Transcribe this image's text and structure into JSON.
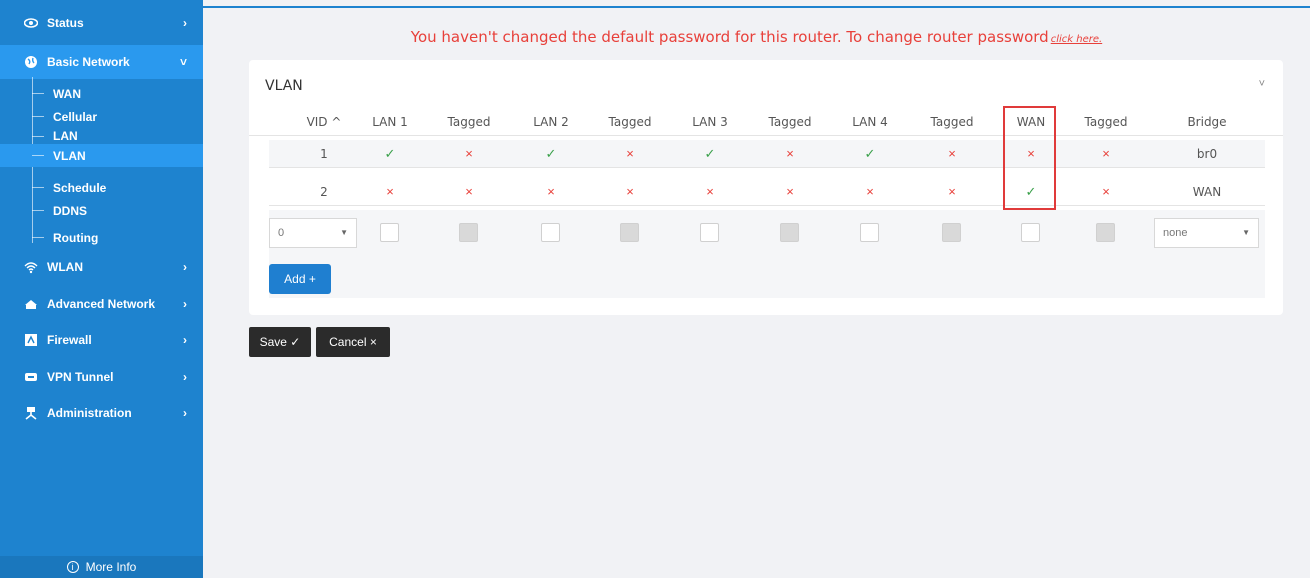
{
  "sidebar": {
    "items": [
      {
        "label": "Status",
        "icon": "eye-icon",
        "chevron": "›"
      },
      {
        "label": "Basic Network",
        "icon": "globe-icon",
        "chevron": "˅"
      },
      {
        "label": "WLAN",
        "icon": "wifi-icon",
        "chevron": "›"
      },
      {
        "label": "Advanced Network",
        "icon": "router-icon",
        "chevron": "›"
      },
      {
        "label": "Firewall",
        "icon": "firewall-icon",
        "chevron": "›"
      },
      {
        "label": "VPN Tunnel",
        "icon": "vpn-icon",
        "chevron": "›"
      },
      {
        "label": "Administration",
        "icon": "admin-icon",
        "chevron": "›"
      }
    ],
    "submenu": [
      "WAN",
      "Cellular",
      "LAN",
      "VLAN",
      "Schedule",
      "DDNS",
      "Routing"
    ],
    "more_info": "More Info",
    "colors": {
      "background": "#1e83cf",
      "active": "#2a99ee"
    }
  },
  "warning": {
    "text": "You haven't changed the default password for this router. To change router password",
    "link": "click here."
  },
  "card": {
    "title": "VLAN",
    "columns": [
      "VID ^",
      "LAN 1",
      "Tagged",
      "LAN 2",
      "Tagged",
      "LAN 3",
      "Tagged",
      "LAN 4",
      "Tagged",
      "WAN",
      "Tagged",
      "Bridge"
    ],
    "rows": [
      {
        "vid": "1",
        "marks": [
          "✓",
          "×",
          "✓",
          "×",
          "✓",
          "×",
          "✓",
          "×",
          "×",
          "×"
        ],
        "bridge": "br0"
      },
      {
        "vid": "2",
        "marks": [
          "×",
          "×",
          "×",
          "×",
          "×",
          "×",
          "×",
          "×",
          "✓",
          "×"
        ],
        "bridge": "WAN"
      }
    ],
    "new_row": {
      "vid_value": "0",
      "bridge_value": "none"
    },
    "add_label": "Add +"
  },
  "actions": {
    "save": "Save ✓",
    "cancel": "Cancel ×"
  }
}
